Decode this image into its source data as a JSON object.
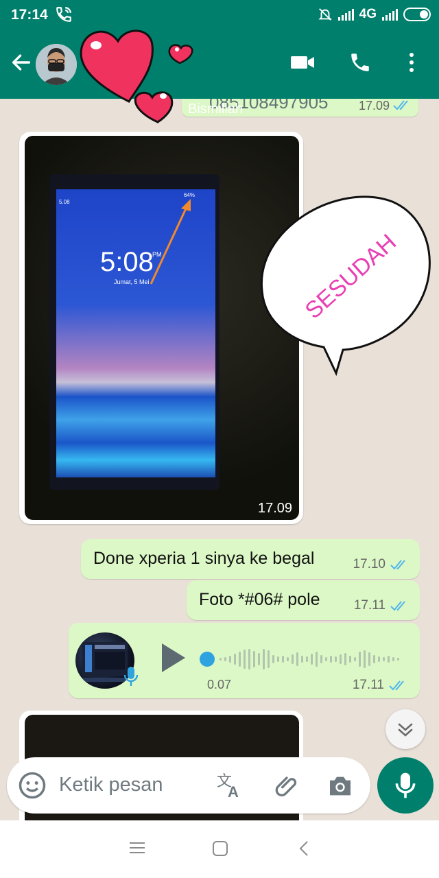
{
  "status_bar": {
    "time": "17:14",
    "network": "4G"
  },
  "chat_header": {
    "icons": [
      "back-arrow-icon",
      "video-call-icon",
      "voice-call-icon",
      "more-options-icon"
    ]
  },
  "messages": {
    "previous": {
      "number": "085108497905",
      "time": "17.09",
      "caption": "Bismillah"
    },
    "photo": {
      "time": "17.09",
      "phone_clock": "5:08",
      "phone_clock_suffix": "PM",
      "phone_date": "Jumat, 5 Mei",
      "phone_status_time": "5.08",
      "phone_battery": "64%"
    },
    "sticker_text": "SESUDAH",
    "text1": {
      "text": "Done xperia 1 sinya ke begal",
      "time": "17.10"
    },
    "text2": {
      "text": "Foto *#06# pole",
      "time": "17.11"
    },
    "voice_note": {
      "duration": "0.07",
      "time": "17.11"
    }
  },
  "input": {
    "placeholder": "Ketik pesan"
  },
  "colors": {
    "header_green": "#00806c",
    "outgoing_bubble": "#dcf8c6",
    "chat_bg": "#e9e1d8",
    "tick_blue": "#4fb6ec",
    "sticker_pink": "#e83fb4"
  }
}
